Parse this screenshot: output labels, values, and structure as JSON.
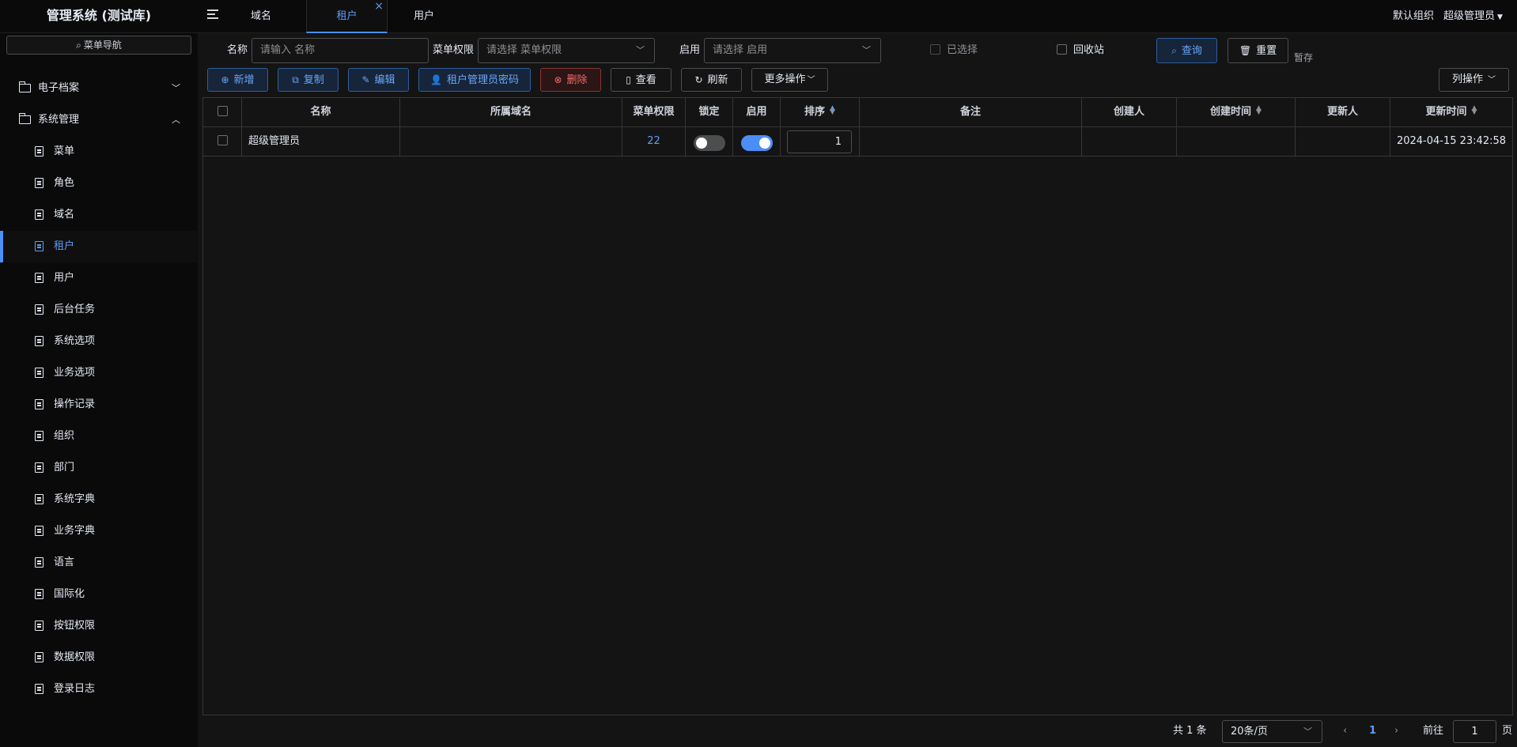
{
  "app": {
    "title": "管理系统 (测试库)"
  },
  "tabs": [
    {
      "label": "域名",
      "active": false
    },
    {
      "label": "租户",
      "active": true
    },
    {
      "label": "用户",
      "active": false
    }
  ],
  "topbar": {
    "org": "默认组织",
    "user": "超级管理员"
  },
  "sidebar": {
    "search_placeholder": "菜单导航",
    "groups": [
      {
        "label": "电子档案",
        "expanded": false
      },
      {
        "label": "系统管理",
        "expanded": true
      }
    ],
    "items": [
      {
        "label": "菜单"
      },
      {
        "label": "角色"
      },
      {
        "label": "域名"
      },
      {
        "label": "租户",
        "active": true
      },
      {
        "label": "用户"
      },
      {
        "label": "后台任务"
      },
      {
        "label": "系统选项"
      },
      {
        "label": "业务选项"
      },
      {
        "label": "操作记录"
      },
      {
        "label": "组织"
      },
      {
        "label": "部门"
      },
      {
        "label": "系统字典"
      },
      {
        "label": "业务字典"
      },
      {
        "label": "语言"
      },
      {
        "label": "国际化"
      },
      {
        "label": "按钮权限"
      },
      {
        "label": "数据权限"
      },
      {
        "label": "登录日志"
      }
    ]
  },
  "filters": {
    "name_label": "名称",
    "name_placeholder": "请输入 名称",
    "menu_label": "菜单权限",
    "menu_placeholder": "请选择 菜单权限",
    "enabled_label": "启用",
    "enabled_placeholder": "请选择 启用",
    "selected_label": "已选择",
    "recycle_label": "回收站",
    "query_label": "查询",
    "reset_label": "重置",
    "stash_label": "暂存"
  },
  "toolbar": {
    "add": "新增",
    "copy": "复制",
    "edit": "编辑",
    "tenant_admin_pwd": "租户管理员密码",
    "delete": "删除",
    "view": "查看",
    "refresh": "刷新",
    "more": "更多操作",
    "columns": "列操作"
  },
  "table": {
    "headers": [
      "名称",
      "所属域名",
      "菜单权限",
      "锁定",
      "启用",
      "排序",
      "备注",
      "创建人",
      "创建时间",
      "更新人",
      "更新时间"
    ],
    "rows": [
      {
        "name": "超级管理员",
        "domain": "",
        "menu_count": "22",
        "locked": false,
        "enabled": true,
        "order": "1",
        "remark": "",
        "creator": "",
        "created_at": "",
        "updater": "",
        "updated_at": "2024-04-15 23:42:58"
      }
    ]
  },
  "pagination": {
    "total": "共 1 条",
    "page_size": "20条/页",
    "current": "1",
    "goto_label": "前往",
    "goto_value": "1",
    "page_suffix": "页"
  },
  "colors": {
    "accent": "#4b8ef5",
    "danger": "#f56c6c",
    "background": "#141414"
  }
}
